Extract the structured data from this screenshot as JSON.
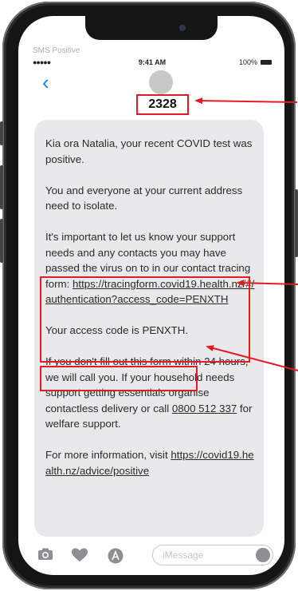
{
  "app": {
    "title": "SMS Positive"
  },
  "status_bar": {
    "signal": "●●●●● ",
    "time": "9:41 AM",
    "battery": "100%"
  },
  "conversation": {
    "back_label": "‹",
    "sender": "2328"
  },
  "message": {
    "p1": "Kia ora Natalia, your recent COVID test was positive.",
    "p2": "You and everyone at your current address need to isolate.",
    "p3_text": "It's important to let us know your support needs and any contacts you may have passed the virus on to in our contact tracing form: ",
    "p3_link": "https://tracingform.covid19.health.nz/#/authentication?access_code=PENXTH",
    "p4": "Your access code is PENXTH.",
    "p5_a": "If you don't fill out this form within 24 hours, we will call you. If your household needs support getting essentials organise contactless delivery or call ",
    "p5_phone": "0800 512 337",
    "p5_b": " for welfare support.",
    "p6_text": "For more information, visit ",
    "p6_link": "https://covid19.health.nz/advice/positive"
  },
  "input_bar": {
    "placeholder": "iMessage"
  },
  "colors": {
    "highlight": "#e51b24",
    "accent": "#1a7cf5",
    "bubble": "#e9e9eb"
  },
  "icons": [
    "camera-icon",
    "heart-hands-icon",
    "appstore-icon",
    "microphone-icon"
  ]
}
